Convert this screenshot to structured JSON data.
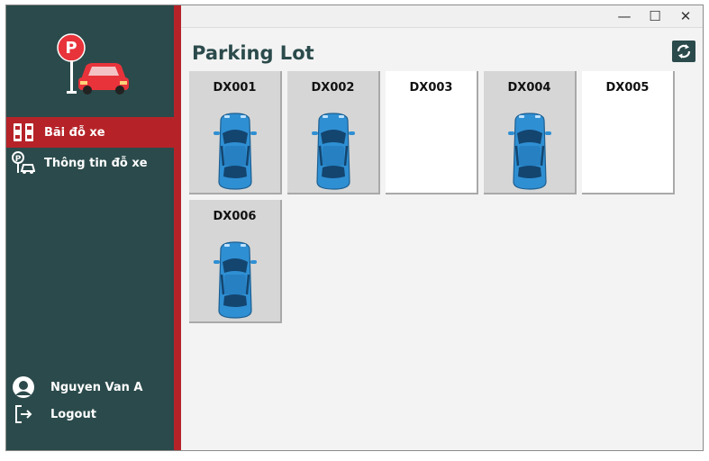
{
  "window": {
    "minimize_glyph": "—",
    "maximize_glyph": "☐",
    "close_glyph": "✕"
  },
  "sidebar": {
    "items": [
      {
        "label": "Bãi đỗ xe",
        "icon": "parking-spaces-icon",
        "active": true
      },
      {
        "label": "Thông tin đỗ xe",
        "icon": "parking-info-icon",
        "active": false
      }
    ],
    "user": {
      "name": "Nguyen Van A",
      "icon": "user-avatar-icon"
    },
    "logout": {
      "label": "Logout",
      "icon": "logout-icon"
    }
  },
  "main": {
    "title": "Parking Lot",
    "refresh_icon": "refresh-icon",
    "slots": [
      {
        "id": "DX001",
        "occupied": true
      },
      {
        "id": "DX002",
        "occupied": true
      },
      {
        "id": "DX003",
        "occupied": false
      },
      {
        "id": "DX004",
        "occupied": true
      },
      {
        "id": "DX005",
        "occupied": false
      },
      {
        "id": "DX006",
        "occupied": true
      }
    ]
  },
  "colors": {
    "sidebar_bg": "#2b4a4b",
    "accent_red": "#b52328",
    "car_blue": "#2f8fd3",
    "occupied_bg": "#d6d6d6",
    "free_bg": "#ffffff"
  }
}
